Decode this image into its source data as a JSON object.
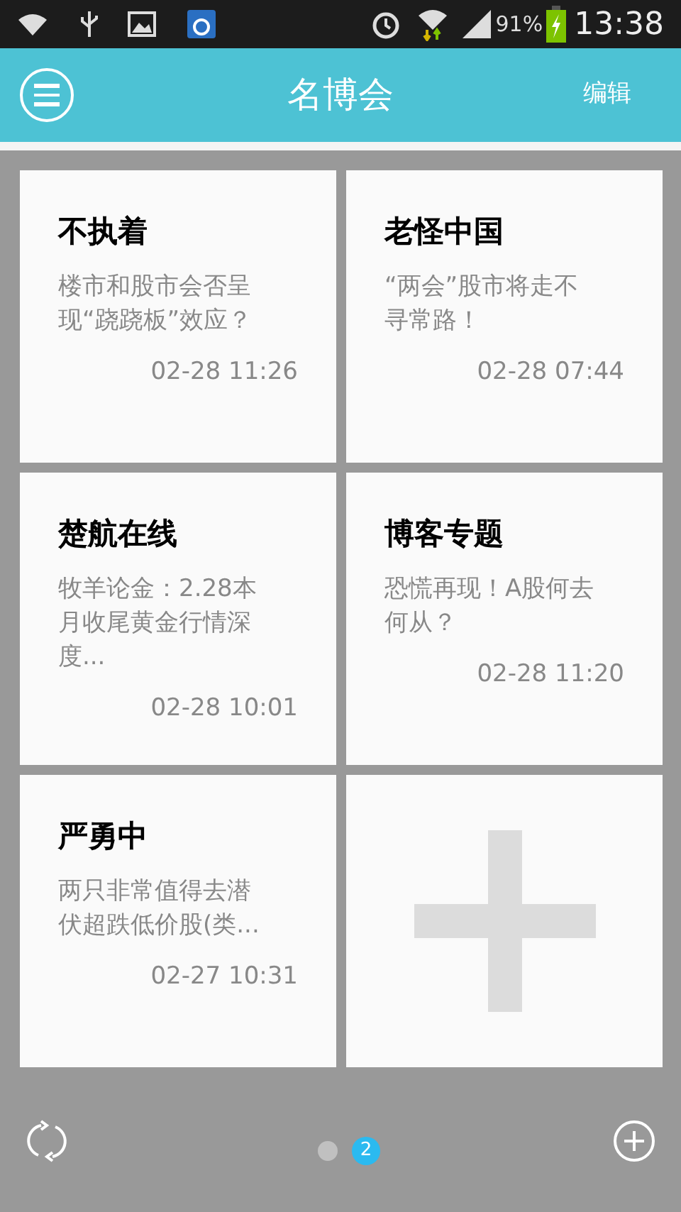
{
  "status_bar": {
    "battery": "91%",
    "time": "13:38"
  },
  "header": {
    "title": "名博会",
    "action": "编辑"
  },
  "cards": [
    {
      "kind": "article",
      "title": "不执着",
      "summary": "楼市和股市会否呈现“跷跷板”效应？",
      "time": "02-28 11:26"
    },
    {
      "kind": "article",
      "title": "老怪中国",
      "summary": "“两会”股市将走不寻常路！",
      "time": "02-28 07:44"
    },
    {
      "kind": "article",
      "title": "楚航在线",
      "summary": "牧羊论金：2.28本月收尾黄金行情深度...",
      "time": "02-28 10:01"
    },
    {
      "kind": "article",
      "title": "博客专题",
      "summary": "恐慌再现！A股何去何从？",
      "time": "02-28 11:20"
    },
    {
      "kind": "article",
      "title": "严勇中",
      "summary": "两只非常值得去潜伏超跌低价股(类...",
      "time": "02-27 10:31"
    },
    {
      "kind": "add"
    }
  ],
  "pager": [
    {
      "selected": false
    },
    {
      "selected": true,
      "label": "2"
    }
  ]
}
